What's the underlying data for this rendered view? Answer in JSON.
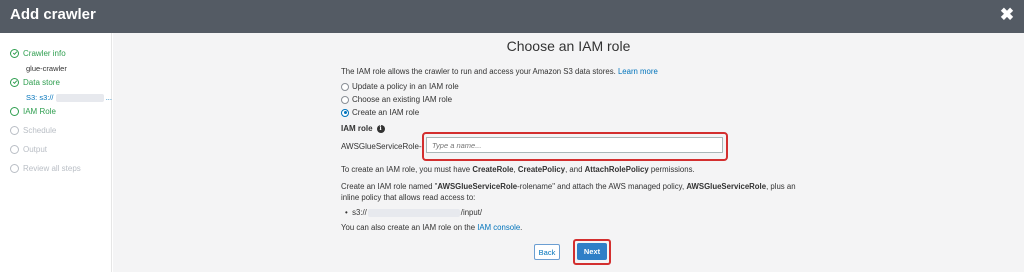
{
  "header": {
    "title": "Add crawler",
    "close_glyph": "✖"
  },
  "sidebar": {
    "steps": [
      {
        "label": "Crawler info",
        "state": "done",
        "sub": "glue-crawler"
      },
      {
        "label": "Data store",
        "state": "done",
        "sub_prefix": "S3: s3://",
        "sub_suffix": "..."
      },
      {
        "label": "IAM Role",
        "state": "current"
      },
      {
        "label": "Schedule",
        "state": "todo"
      },
      {
        "label": "Output",
        "state": "todo"
      },
      {
        "label": "Review all steps",
        "state": "todo"
      }
    ]
  },
  "main": {
    "title": "Choose an IAM role",
    "intro": "The IAM role allows the crawler to run and access your Amazon S3 data stores.",
    "learn_more": "Learn more",
    "options": [
      {
        "label": "Update a policy in an IAM role",
        "checked": false
      },
      {
        "label": "Choose an existing IAM role",
        "checked": false
      },
      {
        "label": "Create an IAM role",
        "checked": true
      }
    ],
    "iam_role_label": "IAM role",
    "info_glyph": "i",
    "role_prefix": "AWSGlueServiceRole-",
    "role_placeholder": "Type a name...",
    "role_value": "",
    "perm_text_1": "To create an IAM role, you must have ",
    "perm_create_role": "CreateRole",
    "perm_sep_1": ", ",
    "perm_create_policy": "CreatePolicy",
    "perm_sep_2": ", and ",
    "perm_attach": "AttachRolePolicy",
    "perm_end": " permissions.",
    "create_text_1": "Create an IAM role named \"",
    "create_role_name": "AWSGlueServiceRole",
    "create_text_2": "-rolename\" and attach the AWS managed policy, ",
    "create_policy_name": "AWSGlueServiceRole",
    "create_text_3": ", plus an inline policy that allows read access to:",
    "bullet_prefix": "s3://",
    "bullet_suffix": "/input/",
    "console_text": "You can also create an IAM role on the ",
    "console_link": "IAM console",
    "console_end": ".",
    "back_label": "Back",
    "next_label": "Next"
  },
  "colors": {
    "header_bg": "#545b64",
    "accent": "#0073bb",
    "success": "#2e9e4f",
    "highlight": "#d32f2f",
    "primary_button": "#2f7fc7"
  }
}
